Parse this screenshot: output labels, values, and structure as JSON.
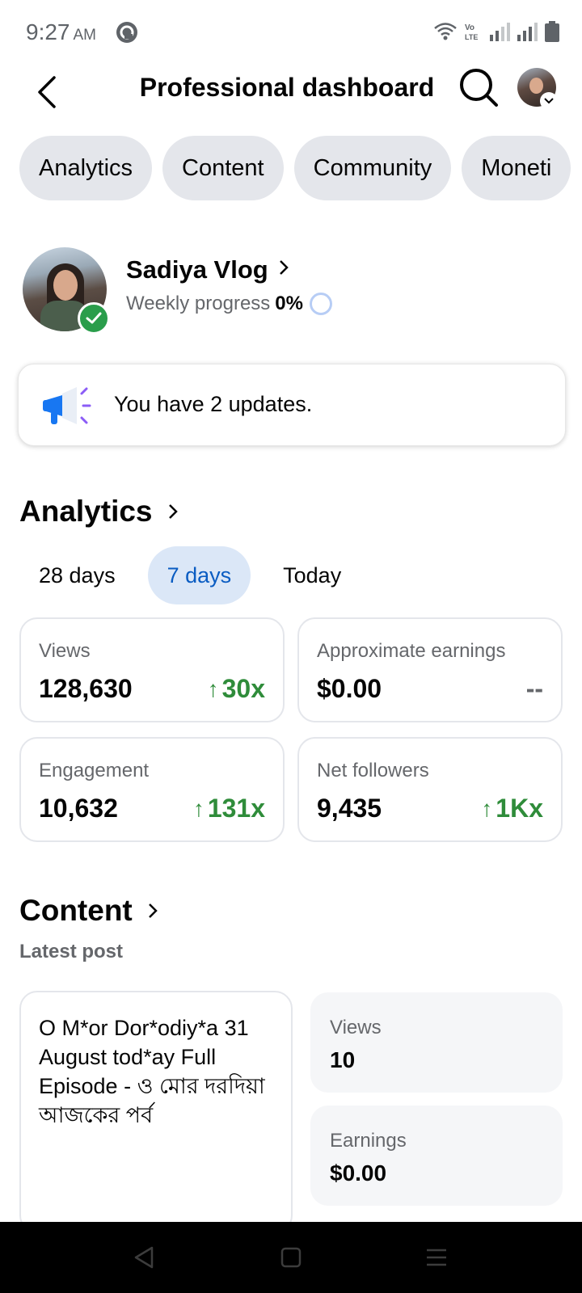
{
  "status_bar": {
    "time": "9:27",
    "ampm": "AM",
    "icons": [
      "app-notification-icon",
      "wifi-icon",
      "volte-icon",
      "signal-icon",
      "signal-icon",
      "battery-icon"
    ]
  },
  "header": {
    "title": "Professional dashboard",
    "icons": [
      "back-arrow-icon",
      "search-icon",
      "avatar",
      "chevron-down-icon"
    ]
  },
  "tabs": [
    "Analytics",
    "Content",
    "Community",
    "Moneti"
  ],
  "profile": {
    "name": "Sadiya Vlog",
    "weekly_label": "Weekly progress",
    "weekly_value": "0%",
    "weekly_progress": 0
  },
  "updates": {
    "text": "You have 2 updates.",
    "icon": "megaphone-icon"
  },
  "analytics": {
    "title": "Analytics",
    "periods": [
      "28 days",
      "7 days",
      "Today"
    ],
    "selected_period": "7 days",
    "metrics": [
      {
        "label": "Views",
        "value": "128,630",
        "change": "30x",
        "trend": "up"
      },
      {
        "label": "Approximate earnings",
        "value": "$0.00",
        "change": "--",
        "trend": "none"
      },
      {
        "label": "Engagement",
        "value": "10,632",
        "change": "131x",
        "trend": "up"
      },
      {
        "label": "Net followers",
        "value": "9,435",
        "change": "1Kx",
        "trend": "up"
      }
    ]
  },
  "content": {
    "title": "Content",
    "latest_label": "Latest post",
    "post_title": "O M*or Dor*odiy*a 31 August tod*ay Full Episode - ও মোর দরদিয়া আজকের পর্ব",
    "stats": [
      {
        "label": "Views",
        "value": "10"
      },
      {
        "label": "Earnings",
        "value": "$0.00"
      }
    ]
  },
  "colors": {
    "accent_blue": "#0a5cc2",
    "active_chip_bg": "#dbe7f7",
    "positive_green": "#2f8c3a",
    "pill_bg": "#e4e6eb",
    "verified_green": "#2a9d4b"
  }
}
